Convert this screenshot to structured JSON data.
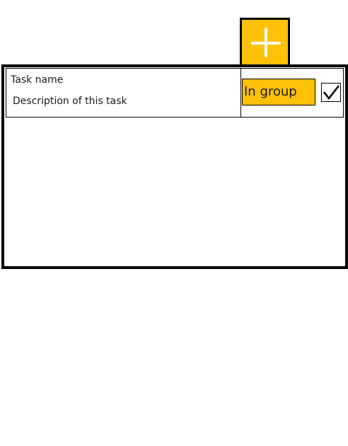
{
  "colors": {
    "accent": "#FFC107",
    "border": "#000000",
    "plus_stroke": "#ffffff"
  },
  "add_button": {
    "icon": "plus-icon"
  },
  "tasks": [
    {
      "name": "Task name",
      "description": "Description of this task",
      "group_label": "In group",
      "completed": true,
      "check_icon": "checkmark-icon"
    }
  ]
}
